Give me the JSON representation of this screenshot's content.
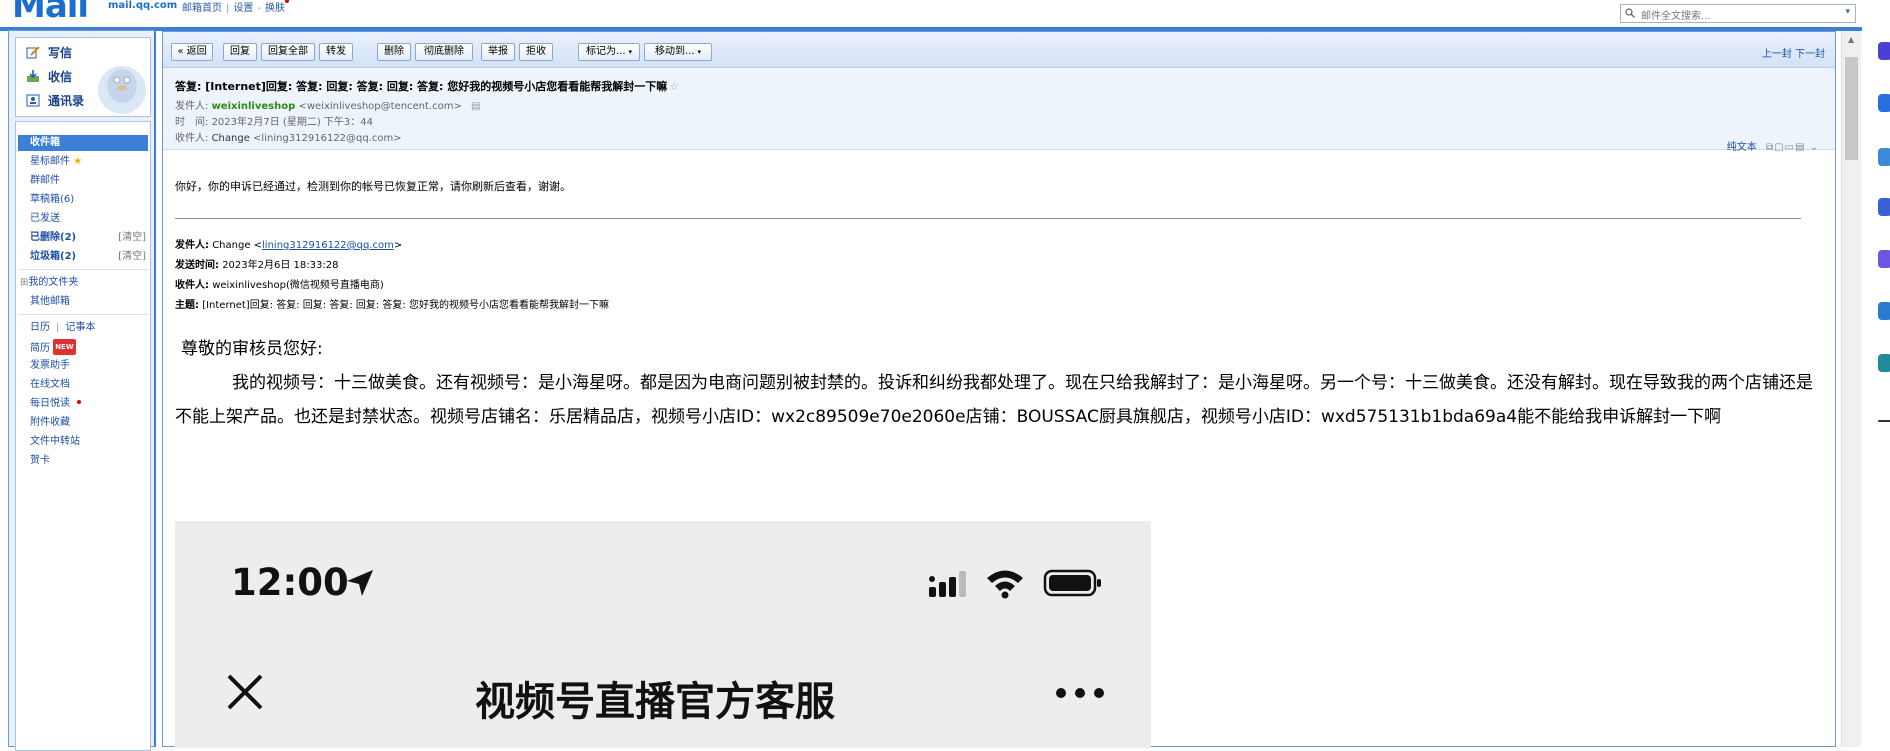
{
  "top": {
    "logo": "Mail",
    "domain": "mail.qq.com",
    "links": [
      "邮箱首页",
      "设置",
      "换肤"
    ],
    "search_placeholder": "邮件全文搜索..."
  },
  "quick": {
    "compose": "写信",
    "inbox": "收信",
    "contacts": "通讯录"
  },
  "folders": {
    "inbox": "收件箱",
    "starred": "星标邮件",
    "group": "群邮件",
    "drafts": "草稿箱(6)",
    "sent": "已发送",
    "deleted": "已删除(2)",
    "spam": "垃圾箱(2)",
    "clear": "[清空]",
    "myfolders": "我的文件夹",
    "other": "其他邮箱",
    "calendar": "日历",
    "notes": "记事本",
    "resume": "简历",
    "new_badge": "NEW",
    "helper": "发票助手",
    "docs": "在线文档",
    "daily": "每日悦读",
    "attachments": "附件收藏",
    "transfer": "文件中转站",
    "cards": "贺卡"
  },
  "toolbar": {
    "back": "« 返回",
    "reply": "回复",
    "reply_all": "回复全部",
    "forward": "转发",
    "delete": "删除",
    "perm_delete": "彻底删除",
    "report": "举报",
    "reject": "拒收",
    "mark_as": "标记为...",
    "move_to": "移动到...",
    "prev": "上一封",
    "next": "下一封"
  },
  "header": {
    "subject": "答复: [Internet]回复: 答复: 回复: 答复: 回复: 答复: 您好我的视频号小店您看看能帮我解封一下嘛",
    "from_label": "发件人:",
    "from_name": "weixinliveshop",
    "from_addr": "<weixinliveshop@tencent.com>",
    "time_label": "时　间:",
    "time_value": "2023年2月7日 (星期二) 下午3：44",
    "to_label": "收件人:",
    "to_name": "Change",
    "to_addr": "<lining312916122@qq.com>",
    "plaintext": "纯文本"
  },
  "body": {
    "greeting": "你好，你的申诉已经通过，检测到你的帐号已恢复正常，请你刷新后查看，谢谢。",
    "q_from_label": "发件人:",
    "q_from_name": "Change <",
    "q_from_email": "lining312916122@qq.com",
    "q_from_end": ">",
    "q_time_label": "发送时间:",
    "q_time": "2023年2月6日 18:33:28",
    "q_to_label": "收件人:",
    "q_to": "weixinliveshop(微信视频号直播电商)",
    "q_subject_label": "主题:",
    "q_subject": "[Internet]回复: 答复: 回复: 答复: 回复: 答复: 您好我的视频号小店您看看能帮我解封一下嘛",
    "salutation": "尊敬的审核员您好:",
    "paragraph": "我的视频号：十三做美食。还有视频号：是小海星呀。都是因为电商问题别被封禁的。投诉和纠纷我都处理了。现在只给我解封了：是小海星呀。另一个号：十三做美食。还没有解封。现在导致我的两个店铺还是不能上架产品。也还是封禁状态。视频号店铺名：乐居精品店，视频号小店ID：wx2c89509e70e2060e店铺：BOUSSAC厨具旗舰店，视频号小店ID：wxd575131b1bda69a4能不能给我申诉解封一下啊"
  },
  "screenshot": {
    "time": "12:00",
    "title": "视频号直播官方客服"
  }
}
